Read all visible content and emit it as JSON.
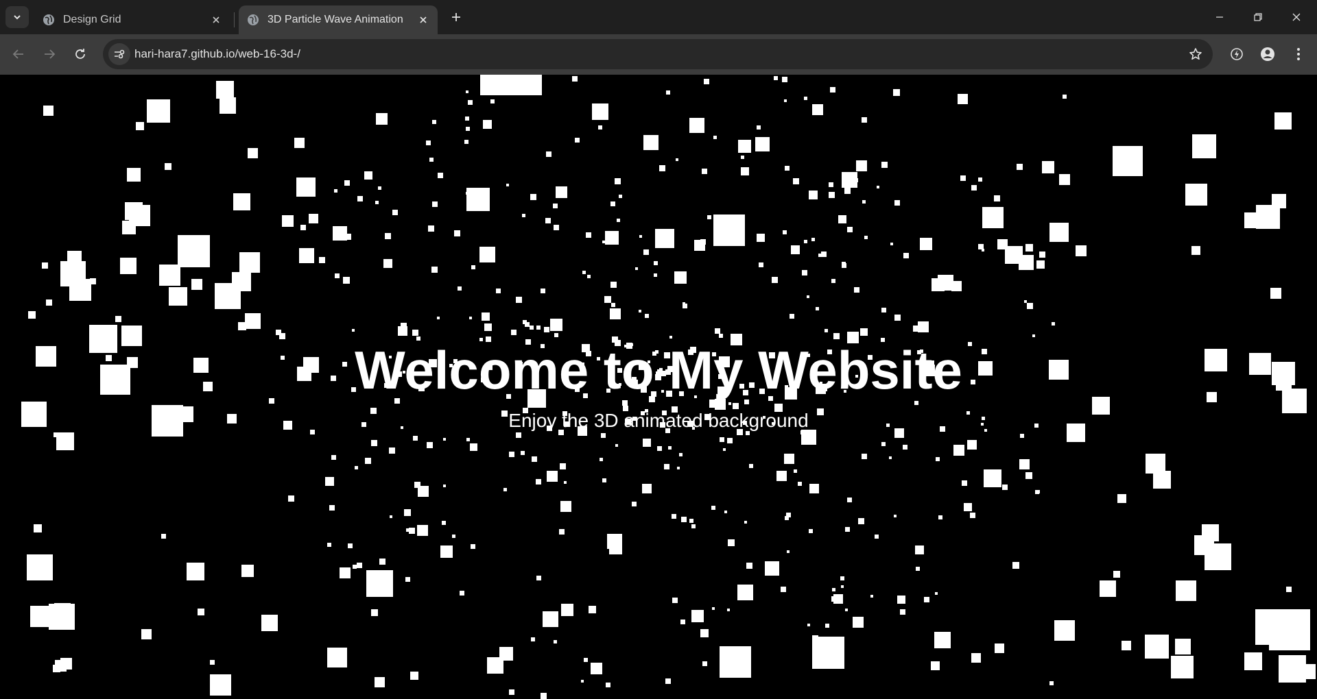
{
  "browser": {
    "tabs": [
      {
        "title": "Design Grid",
        "active": false
      },
      {
        "title": "3D Particle Wave Animation",
        "active": true
      }
    ],
    "url": "hari-hara7.github.io/web-16-3d-/"
  },
  "page": {
    "heading": "Welcome to My Website",
    "subheading": "Enjoy the 3D animated background"
  },
  "colors": {
    "background": "#000000",
    "particle": "#ffffff",
    "text": "#ffffff"
  },
  "icons": [
    "tab-search-icon",
    "globe-icon",
    "close-icon",
    "plus-icon",
    "minimize-icon",
    "restore-icon",
    "window-close-icon",
    "back-icon",
    "forward-icon",
    "reload-icon",
    "site-info-icon",
    "star-icon",
    "extension-icon",
    "profile-icon",
    "menu-icon"
  ]
}
